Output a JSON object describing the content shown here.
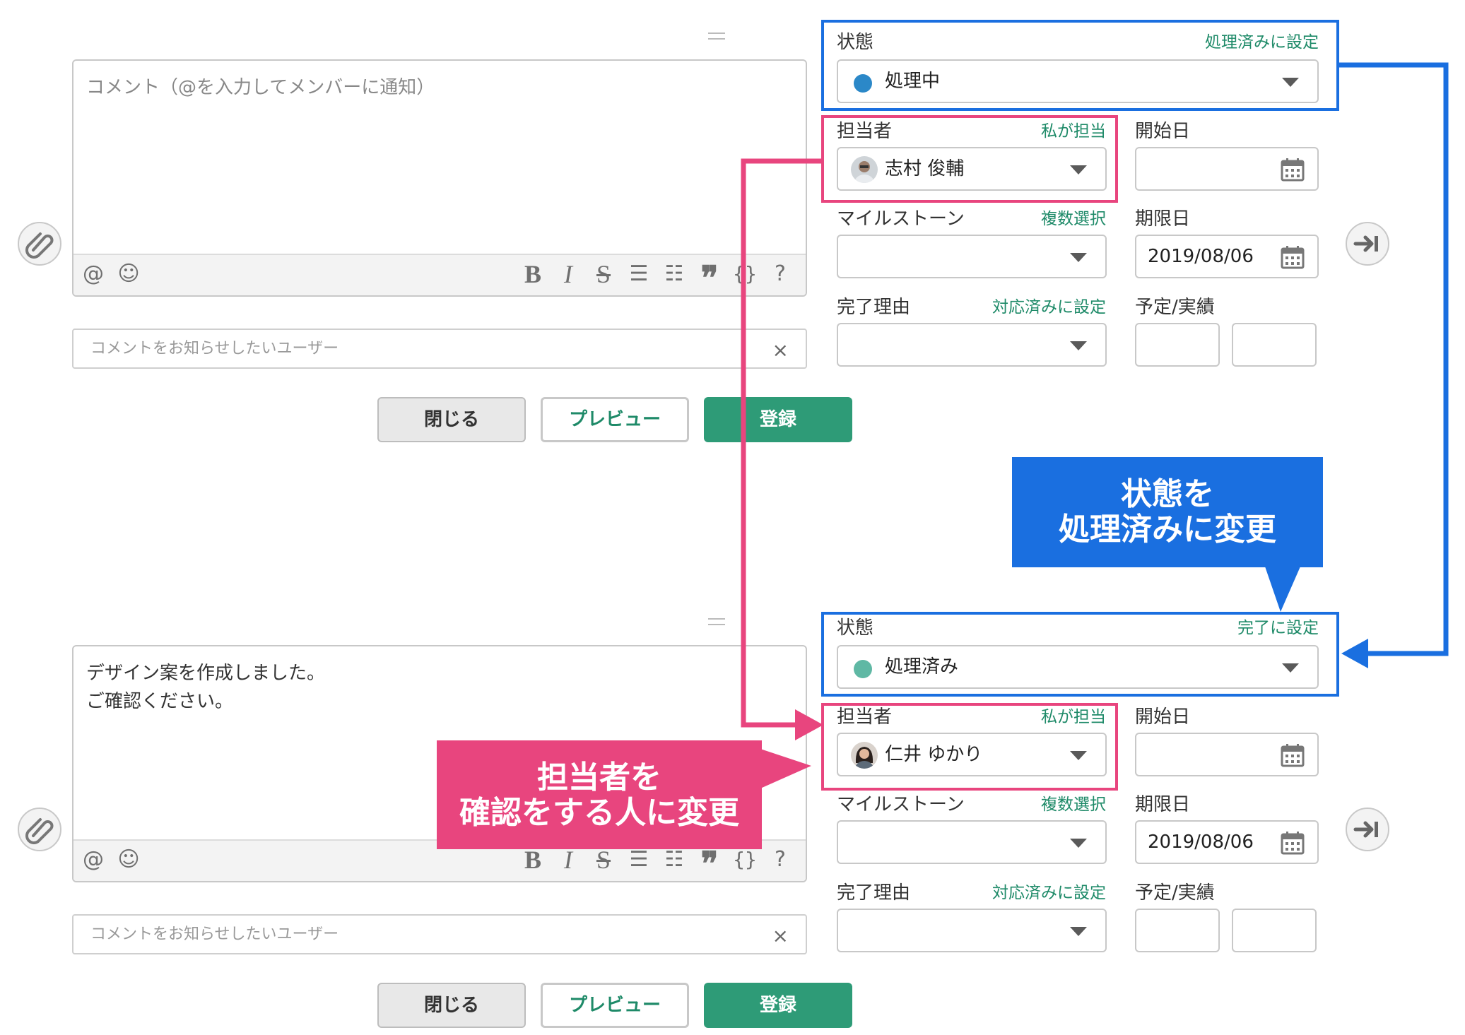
{
  "top": {
    "comment_text": "コメント（@を入力してメンバーに通知）",
    "comment_is_placeholder": true,
    "notify_placeholder": "コメントをお知らせしたいユーザー",
    "status": {
      "label": "状態",
      "link": "処理済みに設定",
      "value": "処理中",
      "color": "#2b88c8"
    },
    "assignee": {
      "label": "担当者",
      "link": "私が担当",
      "value": "志村 俊輔"
    },
    "start_date": {
      "label": "開始日",
      "value": ""
    },
    "milestone": {
      "label": "マイルストーン",
      "link": "複数選択",
      "value": ""
    },
    "due_date": {
      "label": "期限日",
      "value": "2019/08/06"
    },
    "resolution": {
      "label": "完了理由",
      "link": "対応済みに設定",
      "value": ""
    },
    "estimate": {
      "label": "予定/実績",
      "planned": "",
      "actual": ""
    }
  },
  "bottom": {
    "comment_text": "デザイン案を作成しました。\nご確認ください。",
    "notify_placeholder": "コメントをお知らせしたいユーザー",
    "status": {
      "label": "状態",
      "link": "完了に設定",
      "value": "処理済み",
      "color": "#5fb8a4"
    },
    "assignee": {
      "label": "担当者",
      "link": "私が担当",
      "value": "仁井 ゆかり"
    },
    "start_date": {
      "label": "開始日",
      "value": ""
    },
    "milestone": {
      "label": "マイルストーン",
      "link": "複数選択",
      "value": ""
    },
    "due_date": {
      "label": "期限日",
      "value": "2019/08/06"
    },
    "resolution": {
      "label": "完了理由",
      "link": "対応済みに設定",
      "value": ""
    },
    "estimate": {
      "label": "予定/実績",
      "planned": "",
      "actual": ""
    }
  },
  "toolbar": {
    "mention": "@",
    "emoji": "☺",
    "bold": "B",
    "italic": "I",
    "strike": "S",
    "bullet": "☰",
    "numbered": "☷",
    "quote": "❞",
    "code": "{}",
    "help": "?",
    "clear": "×"
  },
  "buttons": {
    "close": "閉じる",
    "preview": "プレビュー",
    "submit": "登録"
  },
  "annotations": {
    "status_line1": "状態を",
    "status_line2": "処理済みに変更",
    "assignee_line1": "担当者を",
    "assignee_line2": "確認をする人に変更"
  },
  "colors": {
    "accent_green": "#2e9b77",
    "link_green": "#1e8a68",
    "callout_blue": "#1a6fe0",
    "callout_pink": "#e8457e"
  }
}
